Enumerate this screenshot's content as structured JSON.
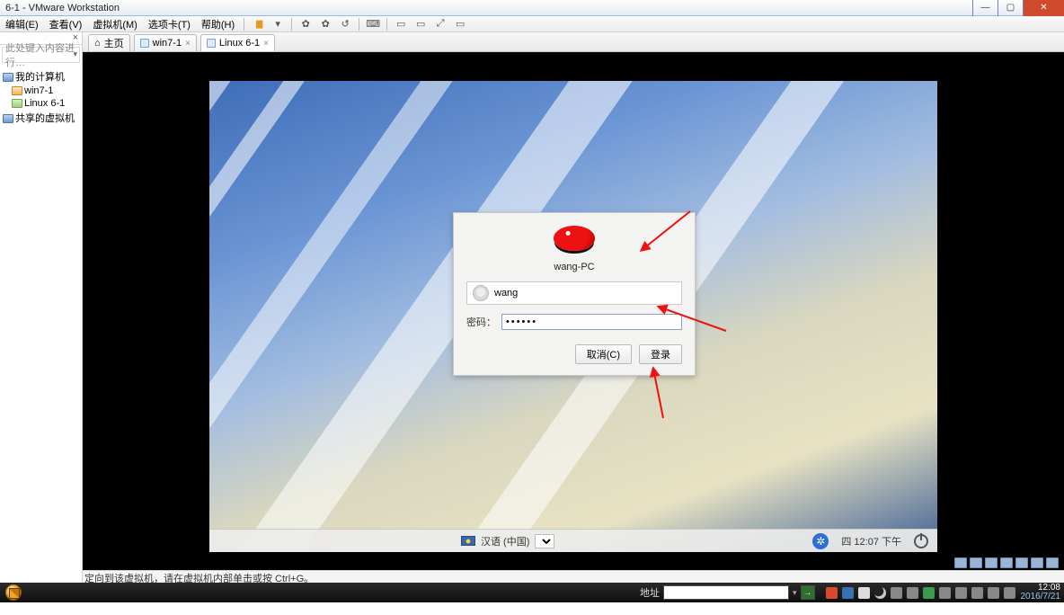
{
  "window": {
    "title": "6-1 - VMware Workstation",
    "min": "—",
    "max": "▢",
    "close": "✕"
  },
  "menu": {
    "edit": "编辑(E)",
    "view": "查看(V)",
    "vm": "虚拟机(M)",
    "tabs": "选项卡(T)",
    "help": "帮助(H)"
  },
  "sidebar": {
    "close_x": "×",
    "search_placeholder": "此处键入内容进行…",
    "nodes": {
      "root": "我的计算机",
      "vm1": "win7-1",
      "vm2": "Linux 6-1",
      "shared": "共享的虚拟机"
    }
  },
  "tabs": [
    {
      "label": "主页",
      "active": false,
      "closeable": false
    },
    {
      "label": "win7-1",
      "active": false,
      "closeable": true
    },
    {
      "label": "Linux 6-1",
      "active": true,
      "closeable": true
    }
  ],
  "login": {
    "hostname": "wang-PC",
    "username": "wang",
    "pw_label": "密码：",
    "pw_value": "••••••",
    "cancel": "取消(C)",
    "submit": "登录"
  },
  "guestbar": {
    "lang": "汉语 (中国)",
    "clock": "四 12:07 下午"
  },
  "hint": "定向到该虚拟机，请在虚拟机内部单击或按 Ctrl+G。",
  "taskbar": {
    "addr_label": "地址",
    "clock_time": "12:08",
    "clock_date": "2016/7/21"
  }
}
